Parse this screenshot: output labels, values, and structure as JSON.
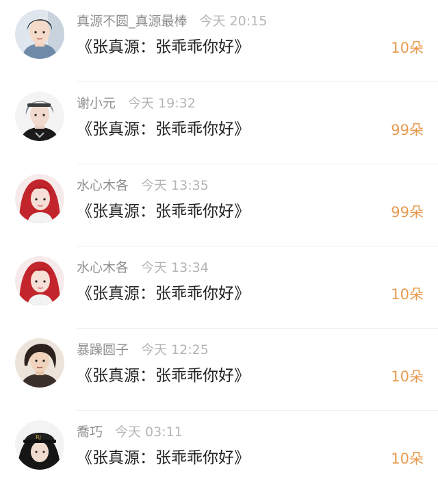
{
  "accent_color": "#e89a4f",
  "comments": [
    {
      "username": "真源不圆_真源最棒",
      "time": "今天 20:15",
      "message": "《张真源：张乖乖你好》",
      "count": "10朵",
      "avatar_icon": "boy-portrait-avatar"
    },
    {
      "username": "谢小元",
      "time": "今天 19:32",
      "message": "《张真源：张乖乖你好》",
      "count": "99朵",
      "avatar_icon": "silver-hair-portrait-avatar"
    },
    {
      "username": "水心木各",
      "time": "今天 13:35",
      "message": "《张真源：张乖乖你好》",
      "count": "99朵",
      "avatar_icon": "red-hair-portrait-avatar"
    },
    {
      "username": "水心木各",
      "time": "今天 13:34",
      "message": "《张真源：张乖乖你好》",
      "count": "10朵",
      "avatar_icon": "red-hair-portrait-avatar"
    },
    {
      "username": "暴躁圆子",
      "time": "今天 12:25",
      "message": "《张真源：张乖乖你好》",
      "count": "10朵",
      "avatar_icon": "illustrated-portrait-avatar"
    },
    {
      "username": "喬巧",
      "time": "今天 03:11",
      "message": "《张真源：张乖乖你好》",
      "count": "10朵",
      "avatar_icon": "cap-portrait-avatar"
    }
  ]
}
